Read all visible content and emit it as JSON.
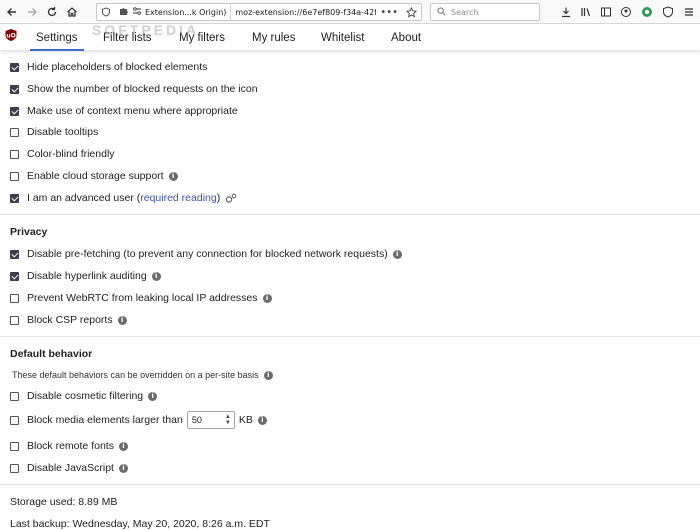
{
  "browser": {
    "url_identity": "Extension...k Origin)",
    "url": "moz-extension://6e7ef809-f34a-42f1",
    "search_placeholder": "Search"
  },
  "watermark": "SOFTPEDIA",
  "nav": {
    "tabs": [
      "Settings",
      "Filter lists",
      "My filters",
      "My rules",
      "Whitelist",
      "About"
    ],
    "active": "Settings"
  },
  "appearance": {
    "items": [
      {
        "label": "Hide placeholders of blocked elements",
        "checked": true
      },
      {
        "label": "Show the number of blocked requests on the icon",
        "checked": true
      },
      {
        "label": "Make use of context menu where appropriate",
        "checked": true
      },
      {
        "label": "Disable tooltips",
        "checked": false
      },
      {
        "label": "Color-blind friendly",
        "checked": false
      },
      {
        "label": "Enable cloud storage support",
        "checked": false
      },
      {
        "label": "I am an advanced user (",
        "checked": true,
        "link": "required reading",
        "suffix": ")"
      }
    ]
  },
  "privacy": {
    "title": "Privacy",
    "items": [
      {
        "label": "Disable pre-fetching (to prevent any connection for blocked network requests)",
        "checked": true
      },
      {
        "label": "Disable hyperlink auditing",
        "checked": true
      },
      {
        "label": "Prevent WebRTC from leaking local IP addresses",
        "checked": false
      },
      {
        "label": "Block CSP reports",
        "checked": false
      }
    ]
  },
  "default_behavior": {
    "title": "Default behavior",
    "note": "These default behaviors can be overridden on a per-site basis",
    "items": [
      {
        "label": "Disable cosmetic filtering",
        "checked": false
      },
      {
        "label": "Block media elements larger than",
        "checked": false,
        "value": "50",
        "unit": "KB"
      },
      {
        "label": "Block remote fonts",
        "checked": false
      },
      {
        "label": "Disable JavaScript",
        "checked": false
      }
    ]
  },
  "storage": {
    "used": "Storage used: 8.89 MB",
    "last_backup": "Last backup: Wednesday, May 20, 2020, 8:26 a.m. EDT"
  },
  "colors": {
    "accent": "#3b6ec8",
    "checkbox_on": "#3d3d4d",
    "link": "#3a55a8"
  }
}
